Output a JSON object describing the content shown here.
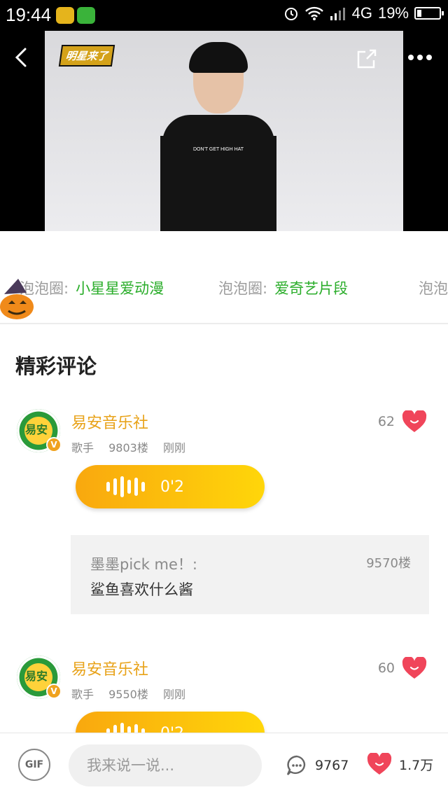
{
  "status_bar": {
    "time": "19:44",
    "network": "4G",
    "battery": "19%"
  },
  "video": {
    "show_logo": "明星来了",
    "shirt_text": "DON'T GET HIGH HAT"
  },
  "circles": [
    {
      "label": "泡泡圈:",
      "name": "小星星爱动漫"
    },
    {
      "label": "泡泡圈:",
      "name": "爱奇艺片段"
    },
    {
      "label": "泡泡",
      "name": ""
    }
  ],
  "section_title": "精彩评论",
  "comments": [
    {
      "user": "易安音乐社",
      "role": "歌手",
      "floor": "9803楼",
      "time": "刚刚",
      "likes": "62",
      "voice_duration": "0'2",
      "avatar_text": "易安",
      "reply": {
        "user": "墨墨pick me！:",
        "floor": "9570楼",
        "text": "鲨鱼喜欢什么酱"
      }
    },
    {
      "user": "易安音乐社",
      "role": "歌手",
      "floor": "9550楼",
      "time": "刚刚",
      "likes": "60",
      "voice_duration": "0'2",
      "avatar_text": "易安"
    }
  ],
  "bottom_bar": {
    "gif_label": "GIF",
    "input_placeholder": "我来说一说...",
    "comment_count": "9767",
    "like_count": "1.7万"
  },
  "colors": {
    "accent_green": "#2aad2a",
    "user_orange": "#e8a218",
    "heart_red": "#f0455a",
    "voice_gradient_start": "#f9a80e",
    "voice_gradient_end": "#ffd60a"
  }
}
